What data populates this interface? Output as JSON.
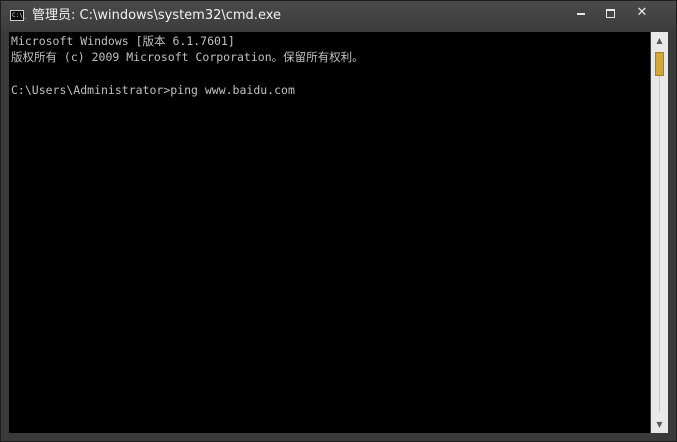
{
  "window": {
    "title": "管理员: C:\\windows\\system32\\cmd.exe",
    "app_icon_glyph": "C:\\_",
    "buttons": {
      "minimize": "minimize",
      "maximize": "maximize",
      "close": "✕"
    }
  },
  "console": {
    "lines": [
      "Microsoft Windows [版本 6.1.7601]",
      "版权所有 (c) 2009 Microsoft Corporation。保留所有权利。",
      "C:\\Users\\Administrator>ping www.baidu.com"
    ],
    "background": "#000000",
    "text_color": "#c0c0c0"
  },
  "scrollbar": {
    "up_arrow": "▲",
    "down_arrow": "▼",
    "thumb_color": "#d4a73a"
  }
}
